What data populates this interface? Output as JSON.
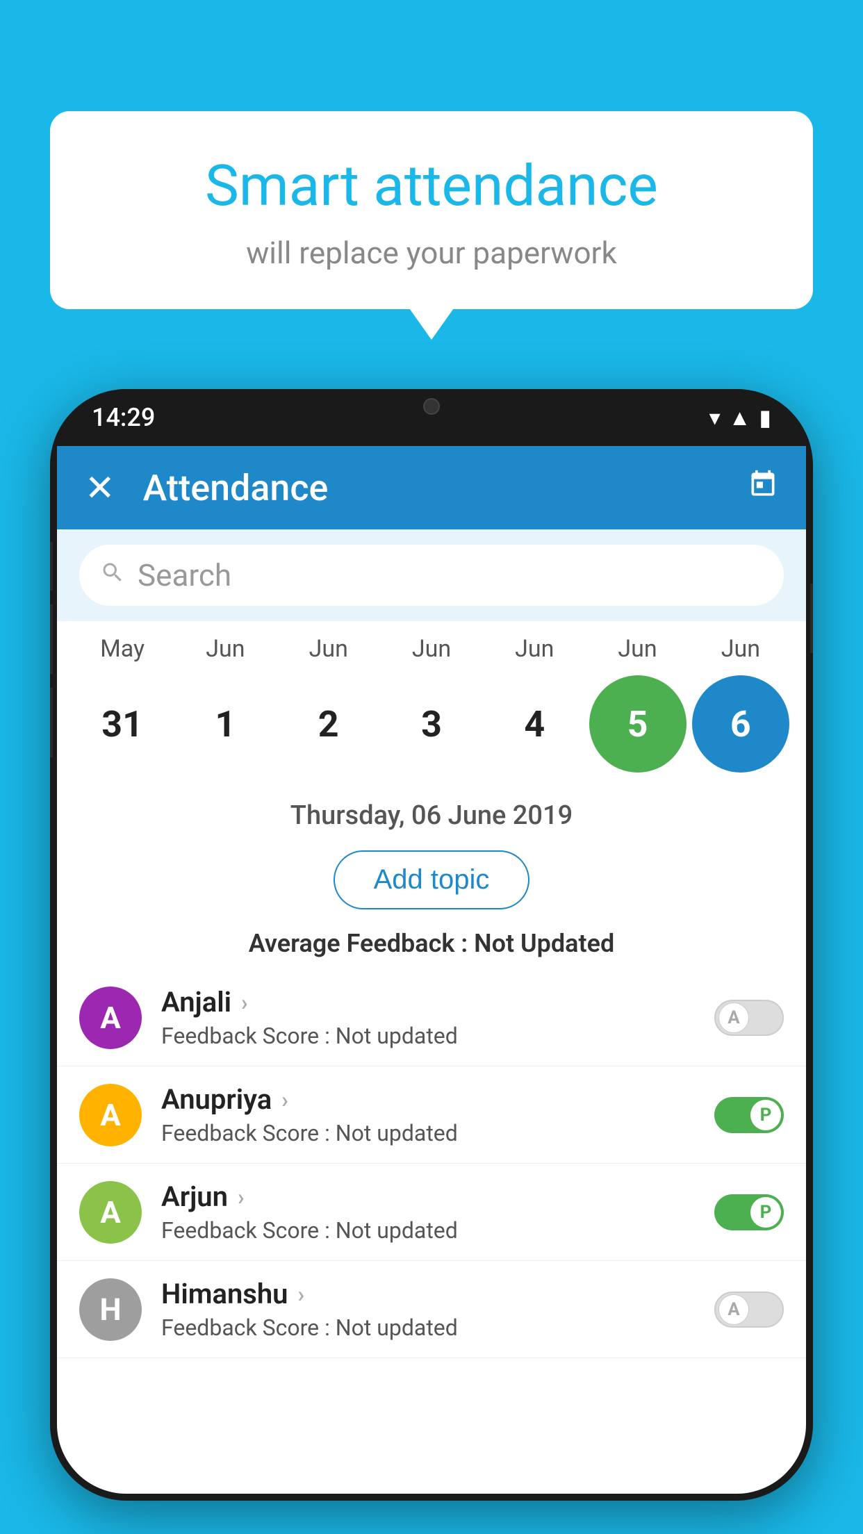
{
  "hero": {
    "title": "Smart attendance",
    "subtitle": "will replace your paperwork"
  },
  "phone": {
    "time": "14:29",
    "app_bar": {
      "title": "Attendance",
      "close_icon": "✕",
      "calendar_icon": "📅"
    },
    "search": {
      "placeholder": "Search"
    },
    "calendar": {
      "months": [
        "May",
        "Jun",
        "Jun",
        "Jun",
        "Jun",
        "Jun",
        "Jun"
      ],
      "dates": [
        {
          "day": "31",
          "state": "normal"
        },
        {
          "day": "1",
          "state": "normal"
        },
        {
          "day": "2",
          "state": "normal"
        },
        {
          "day": "3",
          "state": "normal"
        },
        {
          "day": "4",
          "state": "normal"
        },
        {
          "day": "5",
          "state": "green"
        },
        {
          "day": "6",
          "state": "blue"
        }
      ]
    },
    "selected_date": "Thursday, 06 June 2019",
    "add_topic_label": "Add topic",
    "avg_feedback_label": "Average Feedback : ",
    "avg_feedback_value": "Not Updated",
    "students": [
      {
        "name": "Anjali",
        "avatar_letter": "A",
        "avatar_color": "#9c27b0",
        "feedback_label": "Feedback Score : ",
        "feedback_value": "Not updated",
        "toggle": "absent"
      },
      {
        "name": "Anupriya",
        "avatar_letter": "A",
        "avatar_color": "#ffb300",
        "feedback_label": "Feedback Score : ",
        "feedback_value": "Not updated",
        "toggle": "present"
      },
      {
        "name": "Arjun",
        "avatar_letter": "A",
        "avatar_color": "#8bc34a",
        "feedback_label": "Feedback Score : ",
        "feedback_value": "Not updated",
        "toggle": "present"
      },
      {
        "name": "Himanshu",
        "avatar_letter": "H",
        "avatar_color": "#9e9e9e",
        "feedback_label": "Feedback Score : ",
        "feedback_value": "Not updated",
        "toggle": "absent"
      }
    ]
  }
}
